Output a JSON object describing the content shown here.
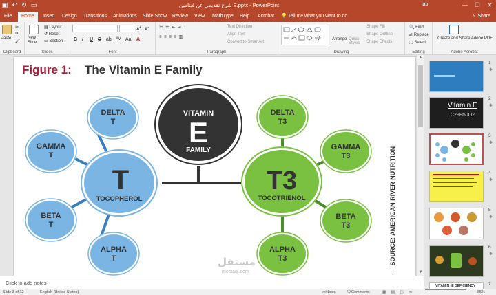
{
  "titlebar": {
    "title": "شرح تقديمي عن فيتامين E.pptx - PowerPoint",
    "user": "lab",
    "minimize": "—",
    "restore": "❐",
    "close": "✕"
  },
  "tabs": [
    "File",
    "Home",
    "Insert",
    "Design",
    "Transitions",
    "Animations",
    "Slide Show",
    "Review",
    "View",
    "MathType",
    "Help",
    "Acrobat"
  ],
  "tell_me": "Tell me what you want to do",
  "share": "Share",
  "ribbon": {
    "clipboard": {
      "paste": "Paste",
      "label": "Clipboard"
    },
    "slides": {
      "new_slide": "New Slide",
      "layout": "Layout",
      "reset": "Reset",
      "section": "Section",
      "label": "Slides"
    },
    "font": {
      "label": "Font",
      "bold": "B",
      "italic": "I",
      "underline": "U",
      "strike": "S",
      "shadow": "ab",
      "spacing": "AV",
      "case": "Aa"
    },
    "paragraph": {
      "text_direction": "Text Direction",
      "align_text": "Align Text",
      "smartart": "Convert to SmartArt",
      "label": "Paragraph"
    },
    "drawing": {
      "arrange": "Arrange",
      "quick_styles": "Quick Styles",
      "shape_fill": "Shape Fill",
      "shape_outline": "Shape Outline",
      "shape_effects": "Shape Effects",
      "label": "Drawing"
    },
    "editing": {
      "find": "Find",
      "replace": "Replace",
      "select": "Select",
      "label": "Editing"
    },
    "acrobat": {
      "create_share": "Create and Share Adobe PDF",
      "label": "Adobe Acrobat"
    }
  },
  "slide": {
    "heading_prefix": "Figure 1:",
    "heading_rest": "The Vitamin E Family",
    "center": {
      "line1": "VITAMIN",
      "letter": "E",
      "line2": "FAMILY"
    },
    "left_hub": {
      "letter": "T",
      "name": "TOCOPHEROL"
    },
    "right_hub": {
      "letter": "T3",
      "name": "TOCOTRIENOL"
    },
    "left_nodes": [
      {
        "l1": "DELTA",
        "l2": "T"
      },
      {
        "l1": "GAMMA",
        "l2": "T"
      },
      {
        "l1": "BETA",
        "l2": "T"
      },
      {
        "l1": "ALPHA",
        "l2": "T"
      }
    ],
    "right_nodes": [
      {
        "l1": "DELTA",
        "l2": "T3"
      },
      {
        "l1": "GAMMA",
        "l2": "T3"
      },
      {
        "l1": "BETA",
        "l2": "T3"
      },
      {
        "l1": "ALPHA",
        "l2": "T3"
      }
    ],
    "source": "— SOURCE: AMERICAN RIVER NUTRITION"
  },
  "thumbnails": [
    {
      "num": "1",
      "star": "✱"
    },
    {
      "num": "2",
      "star": "✱"
    },
    {
      "num": "3",
      "star": "✱"
    },
    {
      "num": "4",
      "star": "✱"
    },
    {
      "num": "5",
      "star": "✱"
    },
    {
      "num": "6",
      "star": "✱"
    },
    {
      "num": "7",
      "star": ""
    }
  ],
  "thumb2_text": "Vitamin E",
  "thumb2_formula": "C29H50O2",
  "thumb7_text": "VITAMIN -E DEFICIENCY",
  "notes_placeholder": "Click to add notes",
  "status": {
    "slide_of": "Slide 3 of 12",
    "language": "English (United States)",
    "notes": "Notes",
    "comments": "Comments",
    "zoom": "85%"
  },
  "watermark": {
    "ar": "مستقل",
    "en": "mostaql.com"
  },
  "colors": {
    "accent": "#b7472a",
    "blue": "#7ab5e3",
    "green": "#7ac142",
    "dark": "#333333",
    "heading_red": "#a8203c"
  }
}
